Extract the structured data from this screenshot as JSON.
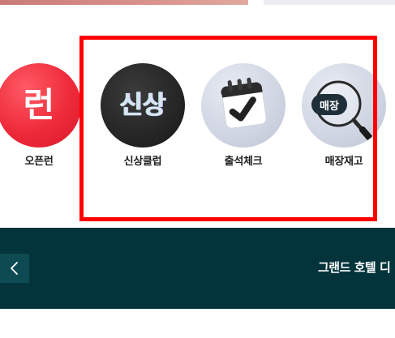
{
  "quick_menu": {
    "items": [
      {
        "label": "오픈런",
        "icon_text": "런",
        "icon": "open-run-badge-icon"
      },
      {
        "label": "신상클럽",
        "icon_text": "신상",
        "icon": "new-arrivals-badge-icon"
      },
      {
        "label": "출석체크",
        "icon": "calendar-check-icon"
      },
      {
        "label": "매장재고",
        "icon_text": "매장",
        "icon": "magnifier-store-icon"
      }
    ]
  },
  "banner": {
    "title": "그랜드 호텔 디",
    "prev_icon": "chevron-left-icon",
    "background": "#03343c"
  },
  "colors": {
    "highlight": "#ff0000",
    "open_run": "#ee2a3a",
    "new_club": "#222222"
  }
}
